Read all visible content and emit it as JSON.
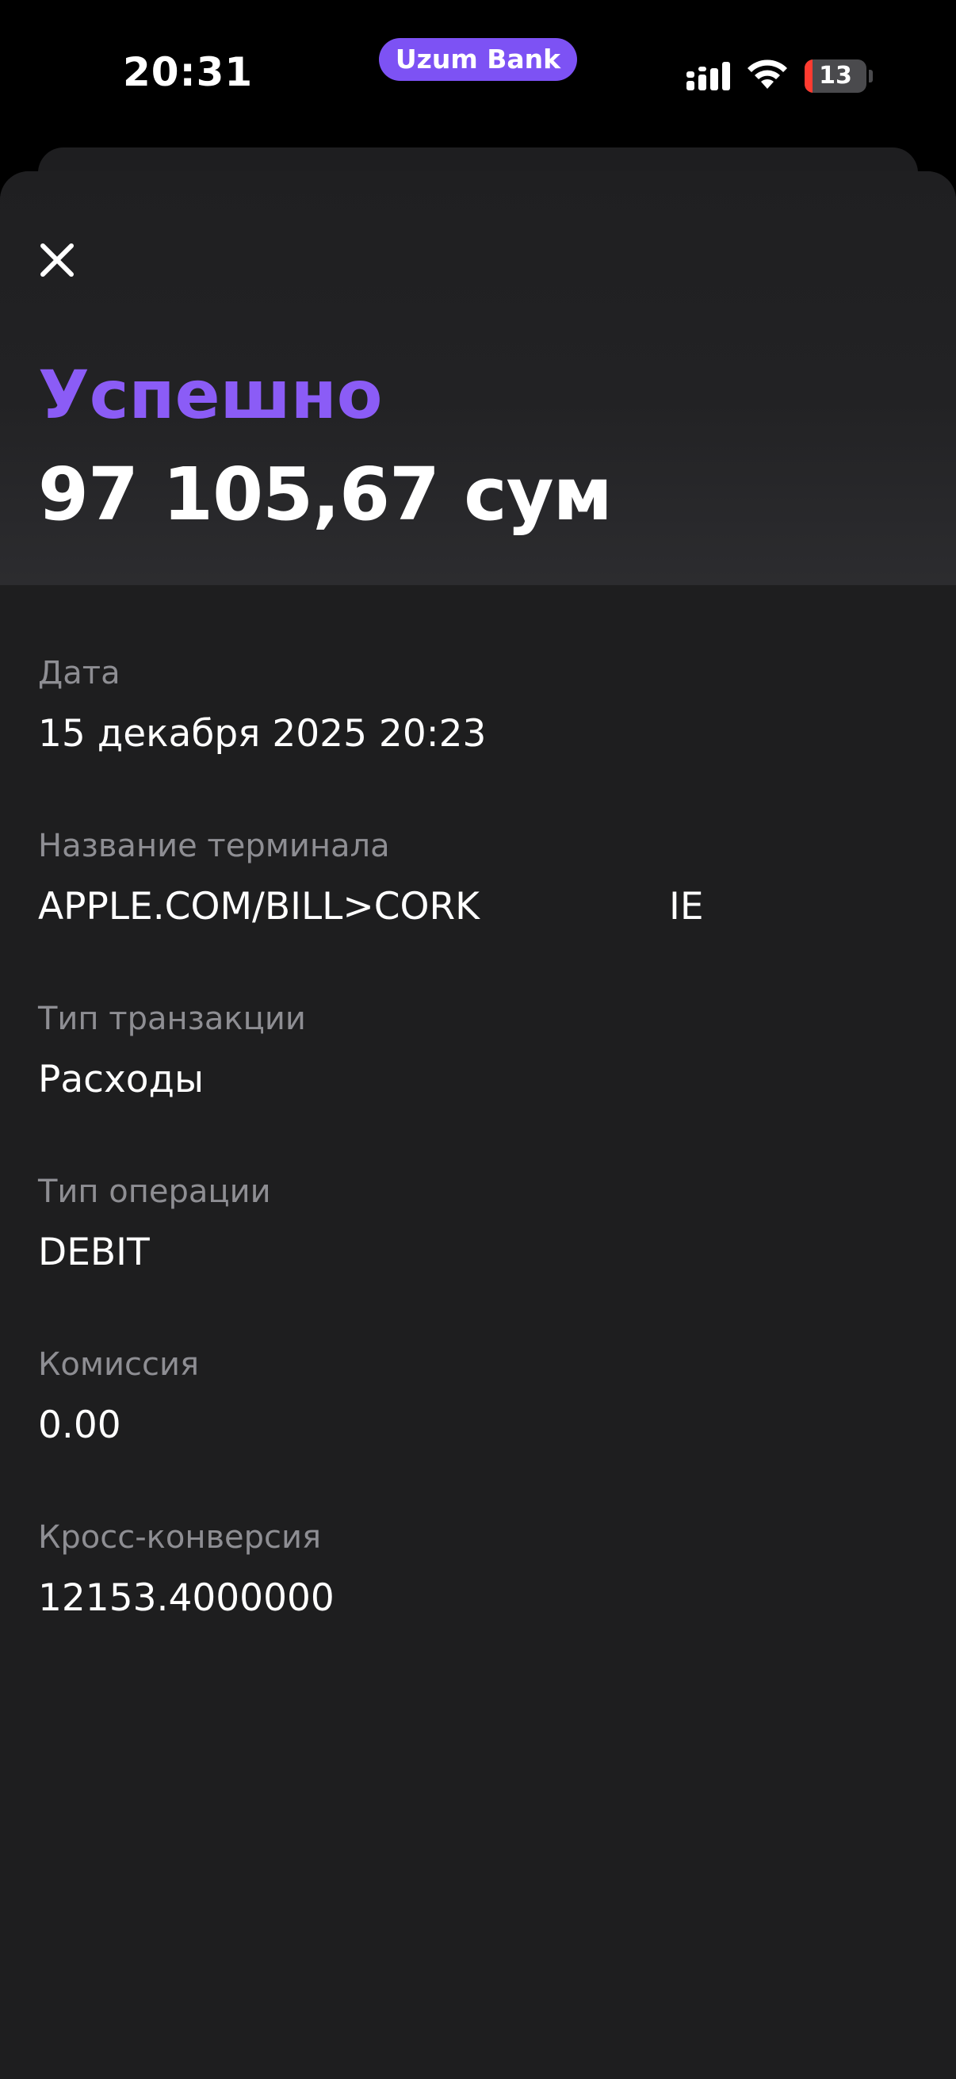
{
  "status_bar": {
    "time": "20:31",
    "carrier_pill": "Uzum Bank",
    "battery_level": "13",
    "battery_fraction": 0.13,
    "icons": [
      "signal-icon",
      "wifi-icon",
      "battery-icon"
    ]
  },
  "colors": {
    "accent": "#8b5cf6",
    "pill": "#7d52f4",
    "background": "#1e1e1f",
    "label": "#8e8e93",
    "battery_low": "#ff3b30"
  },
  "header": {
    "close_icon": "close-icon",
    "status_title": "Успешно",
    "amount": "97 105,67 сум"
  },
  "details": [
    {
      "label": "Дата",
      "value": "15 декабря 2025 20:23"
    },
    {
      "label": "Название терминала",
      "value": "APPLE.COM/BILL>CORK                IE"
    },
    {
      "label": "Тип транзакции",
      "value": "Расходы"
    },
    {
      "label": "Тип операции",
      "value": "DEBIT"
    },
    {
      "label": "Комиссия",
      "value": "0.00"
    },
    {
      "label": "Кросс-конверсия",
      "value": "12153.4000000"
    }
  ]
}
